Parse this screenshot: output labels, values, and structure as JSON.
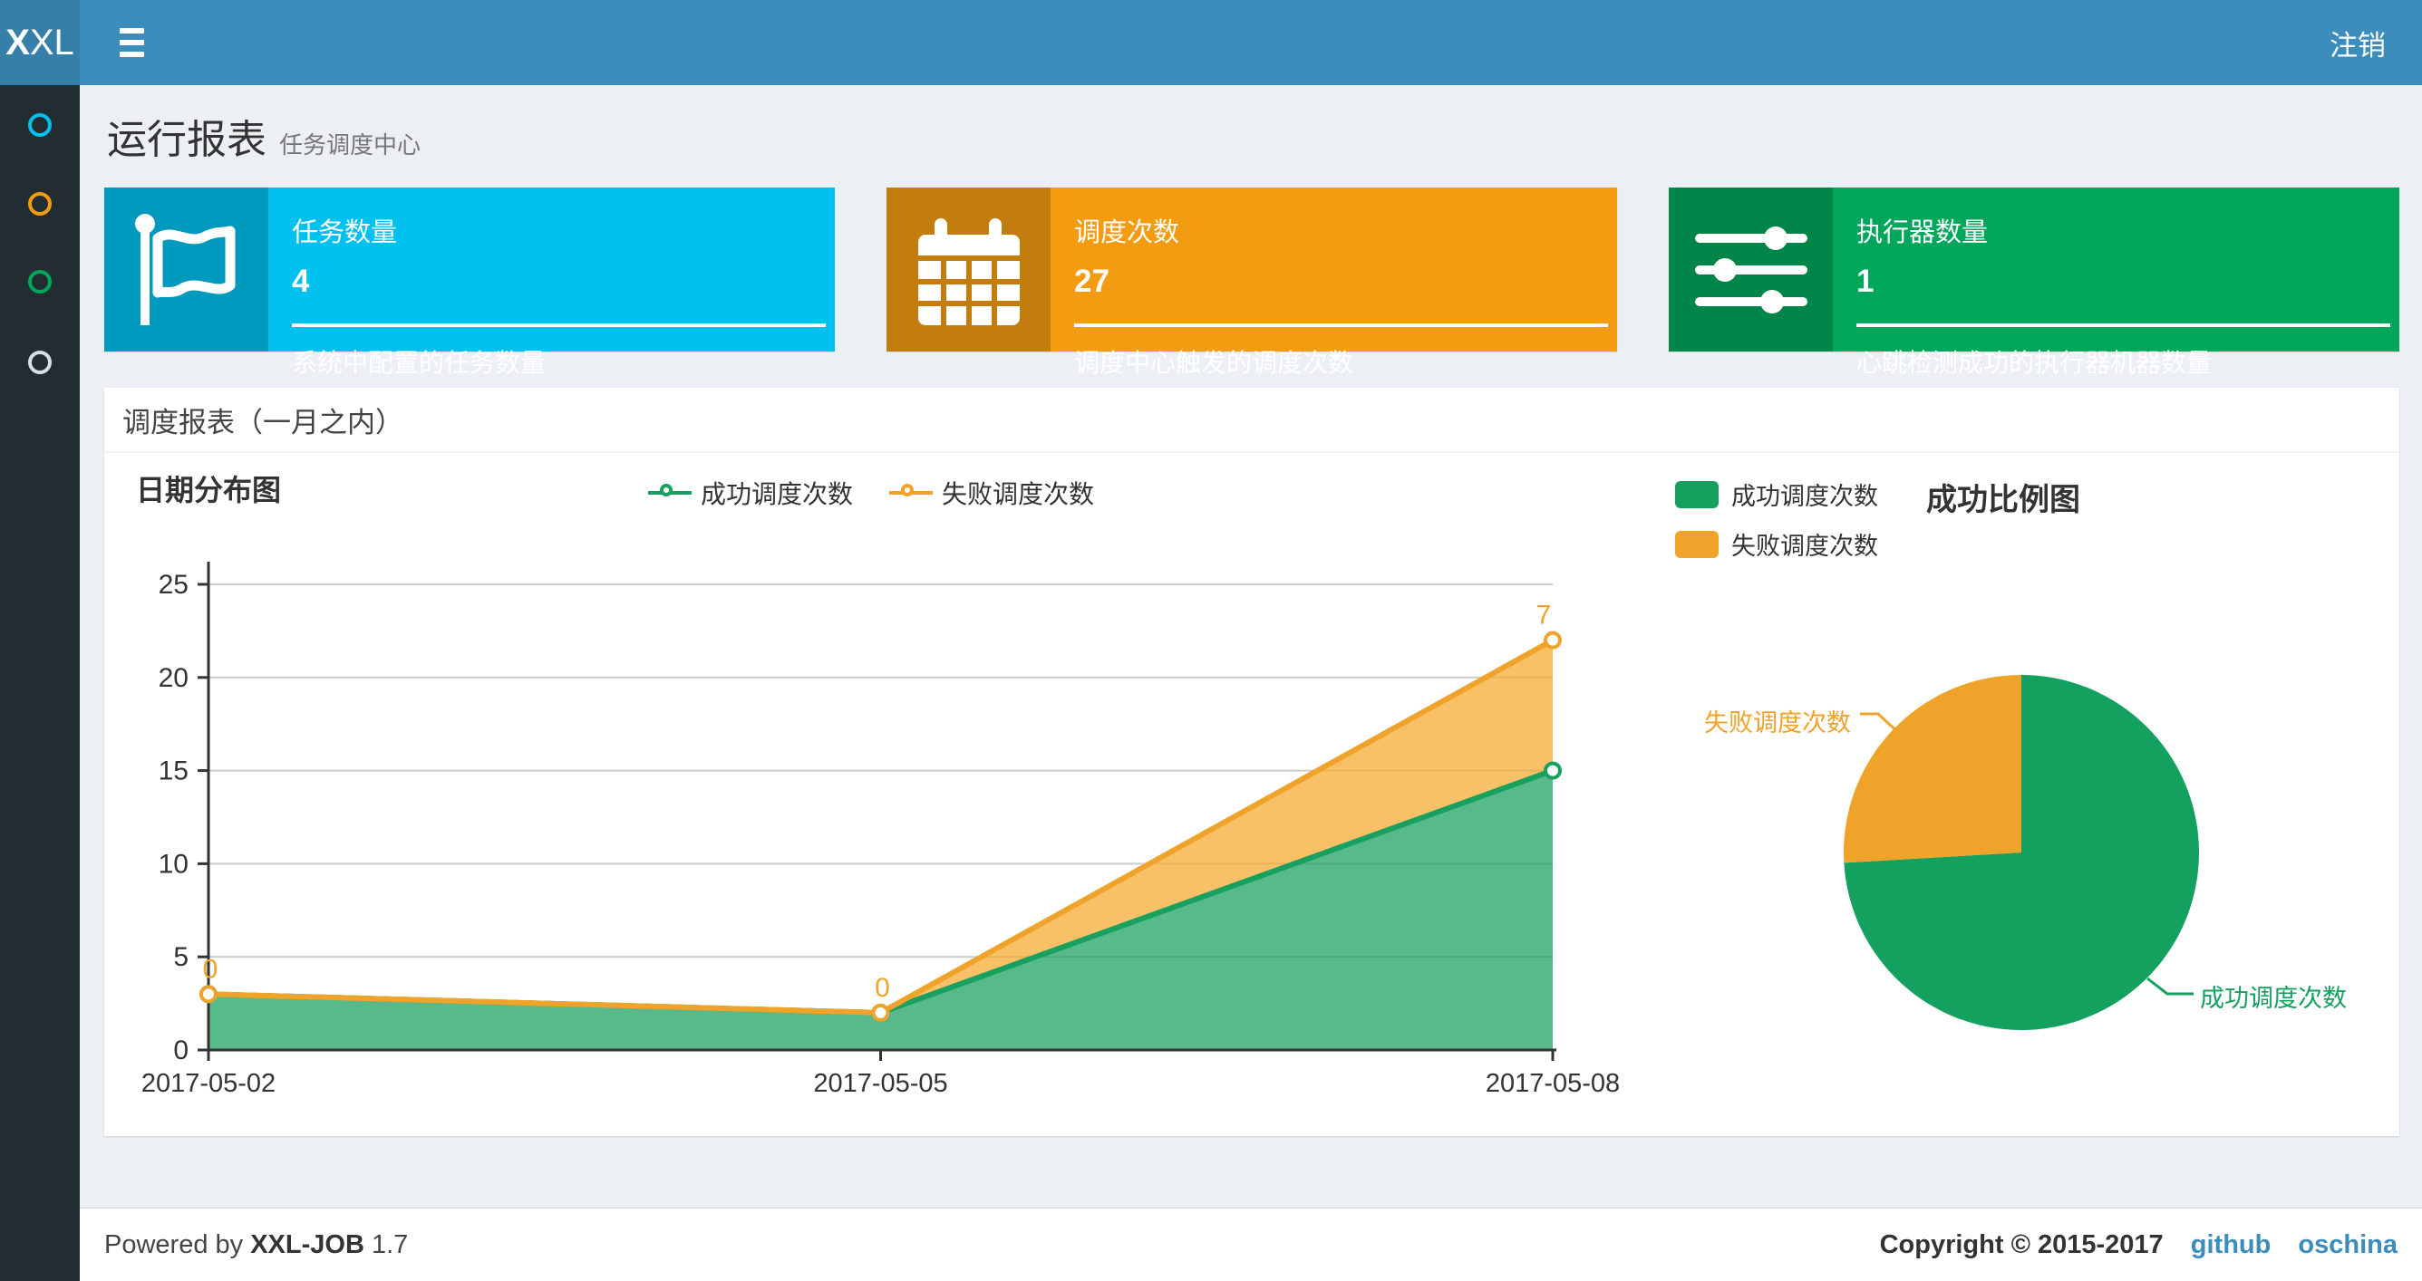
{
  "navbar": {
    "logo_bold": "X",
    "logo_light": "XL",
    "logout_label": "注销"
  },
  "sidebar": {
    "items": [
      {
        "name": "menu-dashboard",
        "color": "#00c0ef"
      },
      {
        "name": "menu-jobs",
        "color": "#f39c12"
      },
      {
        "name": "menu-executors",
        "color": "#00a65a"
      },
      {
        "name": "menu-help",
        "color": "#d8dde2"
      }
    ]
  },
  "page_header": {
    "title": "运行报表",
    "subtitle": "任务调度中心"
  },
  "info_boxes": [
    {
      "icon": "flag-icon",
      "label": "任务数量",
      "value": "4",
      "description": "系统中配置的任务数量",
      "color": "#00c0ef",
      "icon_bg": "#009abf"
    },
    {
      "icon": "calendar-icon",
      "label": "调度次数",
      "value": "27",
      "description": "调度中心触发的调度次数",
      "color": "#f39c12",
      "icon_bg": "#c27d0e"
    },
    {
      "icon": "sliders-icon",
      "label": "执行器数量",
      "value": "1",
      "description": "心跳检测成功的执行器机器数量",
      "color": "#00a65a",
      "icon_bg": "#008548"
    }
  ],
  "panel": {
    "title": "调度报表（一月之内）"
  },
  "chart_data": [
    {
      "type": "area",
      "title": "日期分布图",
      "categories": [
        "2017-05-02",
        "2017-05-05",
        "2017-05-08"
      ],
      "series": [
        {
          "name": "成功调度次数",
          "values": [
            3,
            2,
            15
          ],
          "color": "#17a05e",
          "area_color": "#17a05e"
        },
        {
          "name": "失败调度次数",
          "values": [
            0,
            0,
            7
          ],
          "color": "#f0a32a",
          "area_color": "#f5a82c"
        }
      ],
      "stacked": true,
      "point_labels": [
        "0",
        "0",
        "7"
      ],
      "point_labels_series": "失败调度次数",
      "ylim": [
        0,
        25
      ],
      "yticks": [
        0,
        5,
        10,
        15,
        20,
        25
      ],
      "grid": true,
      "legend_position": "top-center"
    },
    {
      "type": "pie",
      "title": "成功比例图",
      "labels": [
        "成功调度次数",
        "失败调度次数"
      ],
      "values": [
        20,
        7
      ],
      "colors": [
        "#14a05e",
        "#f0a32a"
      ],
      "legend_position": "top-left"
    }
  ],
  "footer": {
    "powered_prefix": "Powered by",
    "brand": "XXL-JOB",
    "version": "1.7",
    "copyright": "Copyright © 2015-2017",
    "links": [
      {
        "label": "github"
      },
      {
        "label": "oschina"
      }
    ]
  }
}
